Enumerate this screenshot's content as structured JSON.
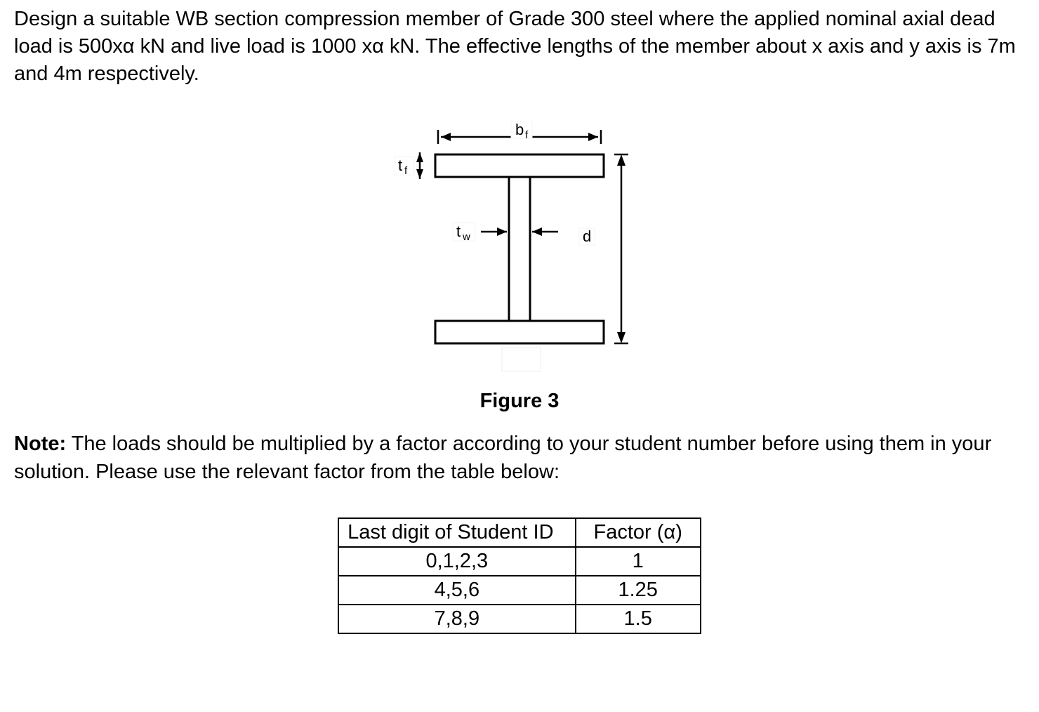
{
  "problem": {
    "text": "Design a suitable WB section compression member of Grade 300 steel where the applied nominal axial dead load is 500xα kN and live load is 1000 xα kN. The effective lengths of the member about x axis and y axis is 7m and 4m respectively."
  },
  "figure": {
    "caption": "Figure 3",
    "labels": {
      "bf": "b",
      "bf_sub": "f",
      "tf": "t",
      "tf_sub": "f",
      "tw": "t",
      "tw_sub": "w",
      "d": "d"
    }
  },
  "note": {
    "label": "Note:",
    "text": " The loads should be multiplied by a factor according to your student number before using them in your solution. Please use the relevant factor from the table below:"
  },
  "table": {
    "headers": [
      "Last digit of Student ID",
      "Factor (α)"
    ],
    "rows": [
      [
        "0,1,2,3",
        "1"
      ],
      [
        "4,5,6",
        "1.25"
      ],
      [
        "7,8,9",
        "1.5"
      ]
    ]
  }
}
